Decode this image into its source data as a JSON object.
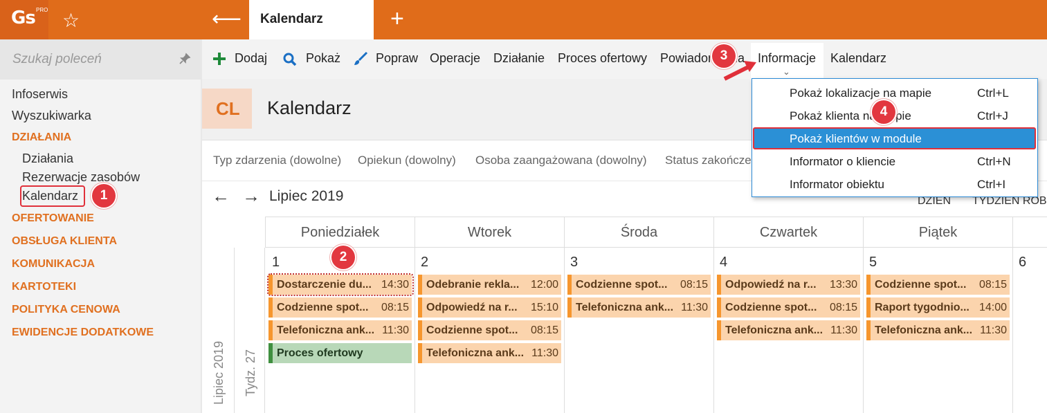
{
  "app": {
    "logo": "Gs",
    "logo_sup": "PRO",
    "tab_title": "Kalendarz"
  },
  "sidebar": {
    "search_placeholder": "Szukaj poleceń",
    "items": [
      "Infoserwis",
      "Wyszukiwarka"
    ],
    "sections": {
      "dzialania": "DZIAŁANIA",
      "sub": [
        "Działania",
        "Rezerwacje zasobów",
        "Kalendarz"
      ]
    },
    "groups": [
      "OFERTOWANIE",
      "OBSŁUGA KLIENTA",
      "KOMUNIKACJA",
      "KARTOTEKI",
      "POLITYKA CENOWA",
      "EWIDENCJE DODATKOWE"
    ]
  },
  "toolbar": {
    "dodaj": "Dodaj",
    "pokaz": "Pokaż",
    "popraw": "Popraw",
    "operacje": "Operacje",
    "dzialanie": "Działanie",
    "proces": "Proces ofertowy",
    "powiadomienia": "Powiadomienia",
    "informacje": "Informacje",
    "kalendarz": "Kalendarz"
  },
  "header": {
    "code": "CL",
    "title": "Kalendarz"
  },
  "filters": [
    "Typ zdarzenia (dowolne)",
    "Opiekun (dowolny)",
    "Osoba zaangażowana (dowolny)",
    "Status zakończenia"
  ],
  "calendar": {
    "month": "Lipiec 2019",
    "views": [
      "DZIEŃ",
      "TYDZIEŃ ROBOCZY"
    ],
    "side_month": "Lipiec 2019",
    "side_week": "Tydz. 27",
    "days": [
      "Poniedziałek",
      "Wtorek",
      "Środa",
      "Czwartek",
      "Piątek"
    ],
    "day_numbers": [
      "1",
      "2",
      "3",
      "4",
      "5",
      "6"
    ],
    "events": [
      [
        {
          "n": "Dostarczenie du...",
          "t": "14:30"
        },
        {
          "n": "Codzienne spot...",
          "t": "08:15"
        },
        {
          "n": "Telefoniczna ank...",
          "t": "11:30"
        },
        {
          "n": "Proces ofertowy",
          "t": ""
        }
      ],
      [
        {
          "n": "Odebranie rekla...",
          "t": "12:00"
        },
        {
          "n": "Odpowiedź na r...",
          "t": "15:10"
        },
        {
          "n": "Codzienne spot...",
          "t": "08:15"
        },
        {
          "n": "Telefoniczna ank...",
          "t": "11:30"
        }
      ],
      [
        {
          "n": "Codzienne spot...",
          "t": "08:15"
        },
        {
          "n": "Telefoniczna ank...",
          "t": "11:30"
        }
      ],
      [
        {
          "n": "Odpowiedź na r...",
          "t": "13:30"
        },
        {
          "n": "Codzienne spot...",
          "t": "08:15"
        },
        {
          "n": "Telefoniczna ank...",
          "t": "11:30"
        }
      ],
      [
        {
          "n": "Codzienne spot...",
          "t": "08:15"
        },
        {
          "n": "Raport tygodnio...",
          "t": "14:00"
        },
        {
          "n": "Telefoniczna ank...",
          "t": "11:30"
        }
      ]
    ]
  },
  "dropdown": [
    {
      "label": "Pokaż lokalizacje na mapie",
      "shortcut": "Ctrl+L"
    },
    {
      "label": "Pokaż klienta na mapie",
      "shortcut": "Ctrl+J"
    },
    {
      "label": "Pokaż klientów w module",
      "shortcut": ""
    },
    {
      "label": "Informator o kliencie",
      "shortcut": "Ctrl+N"
    },
    {
      "label": "Informator obiektu",
      "shortcut": "Ctrl+I"
    }
  ],
  "badges": [
    "1",
    "2",
    "3",
    "4"
  ],
  "icons": {
    "star": "☆",
    "back": "⟵",
    "plus": "+",
    "pin": "📌",
    "nav_prev": "←",
    "nav_next": "→",
    "chevron": "⌄"
  },
  "colors": {
    "accent": "#e06c1a",
    "highlight": "#2b90d6",
    "badge": "#e2373f",
    "event": "#fbd4ad",
    "event_green": "#b8d8b8"
  }
}
